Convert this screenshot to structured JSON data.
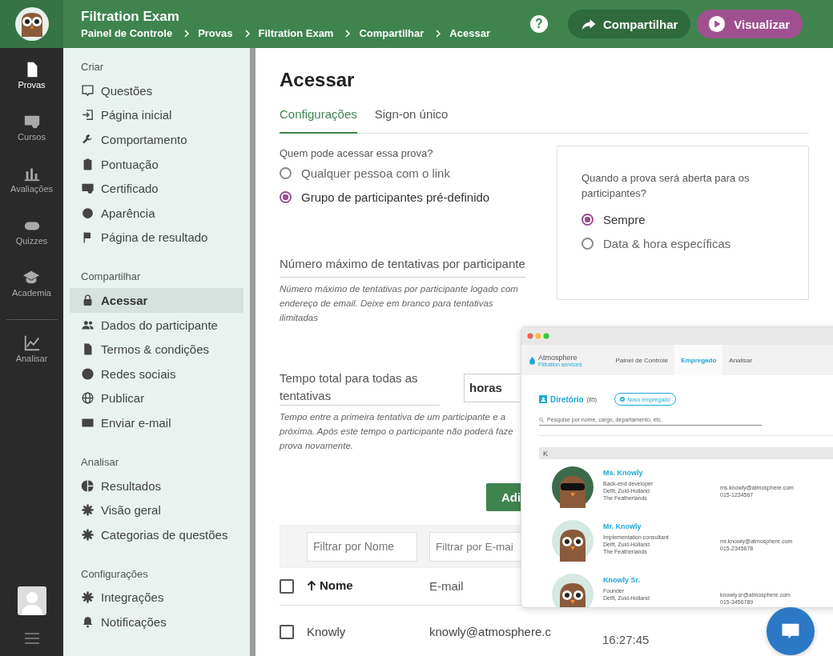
{
  "header": {
    "title": "Filtration Exam",
    "breadcrumbs": [
      "Painel de Controle",
      "Provas",
      "Filtration Exam",
      "Compartilhar",
      "Acessar"
    ],
    "help": "?",
    "share_button": "Compartilhar",
    "preview_button": "Visualizar"
  },
  "rail": [
    {
      "label": "Provas",
      "selected": true
    },
    {
      "label": "Cursos",
      "selected": false
    },
    {
      "label": "Avaliações",
      "selected": false
    },
    {
      "label": "Quizzes",
      "selected": false
    },
    {
      "label": "Academia",
      "selected": false
    },
    {
      "label": "Analisar",
      "selected": false
    }
  ],
  "sidebar": [
    {
      "title": "Criar",
      "items": [
        {
          "label": "Questões",
          "selected": false
        },
        {
          "label": "Página inicial",
          "selected": false
        },
        {
          "label": "Comportamento",
          "selected": false
        },
        {
          "label": "Pontuação",
          "selected": false
        },
        {
          "label": "Certificado",
          "selected": false
        },
        {
          "label": "Aparência",
          "selected": false
        },
        {
          "label": "Página de resultado",
          "selected": false
        }
      ]
    },
    {
      "title": "Compartilhar",
      "items": [
        {
          "label": "Acessar",
          "selected": true
        },
        {
          "label": "Dados do participante",
          "selected": false
        },
        {
          "label": "Termos & condições",
          "selected": false
        },
        {
          "label": "Redes sociais",
          "selected": false
        },
        {
          "label": "Publicar",
          "selected": false
        },
        {
          "label": "Enviar e-mail",
          "selected": false
        }
      ]
    },
    {
      "title": "Analisar",
      "items": [
        {
          "label": "Resultados",
          "selected": false
        },
        {
          "label": "Visão geral",
          "selected": false
        },
        {
          "label": "Categorias de questões",
          "selected": false
        }
      ]
    },
    {
      "title": "Configurações",
      "items": [
        {
          "label": "Integrações",
          "selected": false
        },
        {
          "label": "Notificações",
          "selected": false
        }
      ]
    }
  ],
  "page": {
    "title": "Acessar",
    "tabs": [
      {
        "label": "Configurações",
        "selected": true
      },
      {
        "label": "Sign-on único",
        "selected": false
      }
    ]
  },
  "access": {
    "question": "Quem pode acessar essa prova?",
    "options": [
      {
        "label": "Qualquer pessoa com o link",
        "selected": false
      },
      {
        "label": "Grupo de participantes pré-definido",
        "selected": true
      }
    ]
  },
  "schedule": {
    "question": "Quando a prova será aberta para os participantes?",
    "options": [
      {
        "label": "Sempre",
        "selected": true
      },
      {
        "label": "Data & hora específicas",
        "selected": false
      }
    ]
  },
  "max_attempts": {
    "label": "Número máximo de tentativas por participante",
    "hint": "Número máximo de tentativas por participante logado com endereço de email. Deixe em branco para tentativas ilimitadas"
  },
  "total_time": {
    "label": "Tempo total para todas as tentativas",
    "unit": "horas",
    "hint": "Tempo entre a primeira tentativa de um participante e a próxima. Após este tempo o participante não poderá faze prova novamente."
  },
  "add_button": "Adi",
  "filters": [
    {
      "placeholder": "Filtrar por Nome"
    },
    {
      "placeholder": "Filtrar por E-mai"
    }
  ],
  "table": {
    "header_checked": false,
    "columns": [
      {
        "label": "Nome",
        "sorted": true
      },
      {
        "label": "E-mail",
        "sorted": false
      }
    ],
    "rows": [
      {
        "checked": false,
        "cells": [
          "Knowly",
          "knowly@atmosphere.c",
          "16:27:45"
        ]
      }
    ]
  },
  "preview_window": {
    "brand": "Atmosphere",
    "brand_sub": "Filtration services",
    "nav": [
      {
        "label": "Painel de Controle",
        "selected": false
      },
      {
        "label": "Empregado",
        "selected": true
      },
      {
        "label": "Analisar",
        "selected": false
      }
    ],
    "directory": "Diretório",
    "count": "(85)",
    "new_button": "Novo empregado",
    "search_placeholder": "Pesquise por nome, cargo, departamento, etc.",
    "group": "K",
    "people": [
      {
        "name": "Ms. Knowly",
        "lines": [
          "Back-end developer",
          "Delft, Zuid-Holland",
          "The Featherlands"
        ],
        "email": "ms.knowly@atmosphere.com",
        "phone": "015-1234567"
      },
      {
        "name": "Mr. Knowly",
        "lines": [
          "Implementation consultant",
          "Delft, Zuid-Holland",
          "The Featherlands"
        ],
        "email": "mr.knowly@atmosphere.com",
        "phone": "015-2345678"
      },
      {
        "name": "Knowly Sr.",
        "lines": [
          "Founder",
          "Delft, Zuid-Holland"
        ],
        "email": "knowly.sr@atmosphere.com",
        "phone": "015-3456789"
      }
    ]
  }
}
